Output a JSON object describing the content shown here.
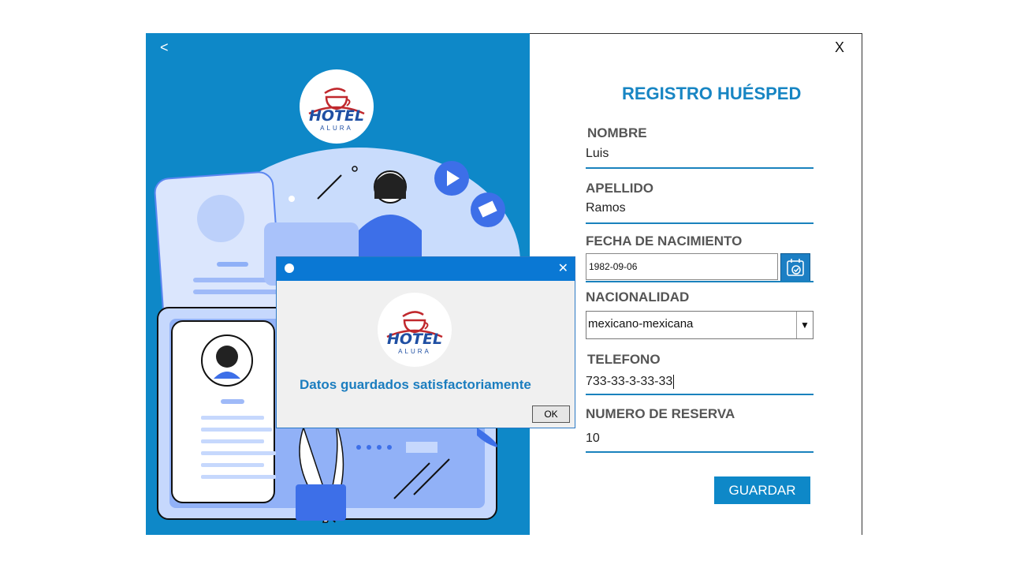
{
  "window": {
    "back_label": "<",
    "close_label": "X"
  },
  "logo": {
    "line1": "HOTEL",
    "line2": "ALURA"
  },
  "form": {
    "title": "REGISTRO HUÉSPED",
    "nombre_label": "NOMBRE",
    "nombre_value": "Luis",
    "apellido_label": "APELLIDO",
    "apellido_value": "Ramos",
    "fecha_label": "FECHA DE NACIMIENTO",
    "fecha_value": "1982-09-06",
    "nacionalidad_label": "NACIONALIDAD",
    "nacionalidad_value": "mexicano-mexicana",
    "telefono_label": "TELEFONO",
    "telefono_value": "733-33-3-33-33",
    "reserva_label": "NUMERO DE RESERVA",
    "reserva_value": "10",
    "save_label": "GUARDAR"
  },
  "dialog": {
    "close_label": "✕",
    "message": "Datos guardados satisfactoriamente",
    "ok_label": "OK"
  },
  "colors": {
    "accent": "#0e88c8",
    "title": "#1785c3",
    "dialog_titlebar": "#0a78d4"
  }
}
